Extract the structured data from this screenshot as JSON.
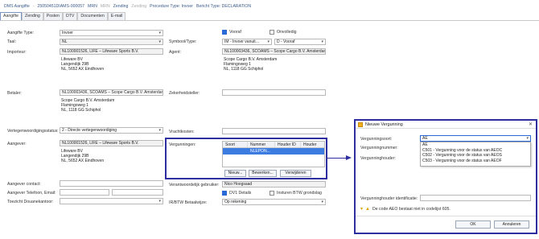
{
  "titlebar": {
    "app": "DMS Aangifte",
    "ref": "25050451DIAMS-000057",
    "mrn_label": "MRN",
    "mrn_value": "MRN",
    "zending_label": "Zending",
    "zending_value": "Zending",
    "procedure": "Procedure Type: Invoer",
    "bericht": "Bericht Type: DECLARATION"
  },
  "tabs": [
    "Aangifte",
    "Zending",
    "Posten",
    "DTV",
    "Documenten",
    "E-mail"
  ],
  "form": {
    "aangifte_type_label": "Aangifte Type:",
    "aangifte_type_value": "Invoer",
    "taal_label": "Taal:",
    "taal_value": "NL",
    "importeur_label": "Importeur:",
    "importeur_value": "NL100001526, LIFE – Lifeware Sports B.V.",
    "importeur_addr": [
      "Lifeware BV",
      "Langendijk 29B",
      "NL, 5652 AX Eindhoven"
    ],
    "betaler_label": "Betaler:",
    "betaler_value": "NL100003436, SCOAMS – Scope Cargo B.V. Amsterdam",
    "betaler_addr": [
      "Scope Cargo B.V. Amsterdam",
      "Flamingoweg 1",
      "NL, 1118 GG Schiphol"
    ],
    "vertegenwoordiging_label": "Vertegenwoordigingsstatus:",
    "vertegenwoordiging_value": "2 - Directe vertegenwoordiging",
    "aangever_label": "Aangever:",
    "aangever_value": "NL100001526, LIFE – Lifeware Sports B.V.",
    "aangever_addr": [
      "Lifeware BV",
      "Langendijk 29B",
      "NL, 5652 AX Eindhoven"
    ],
    "contact_label": "Aangever contact:",
    "telefoon_label": "Aangever Telefoon, Email:",
    "toezicht_label": "Toezicht Douanekantoor:",
    "vooraf_label": "Vooraf",
    "onvolledig_label": "Onvolledig",
    "symbool_label": "Symbool/Type:",
    "symbool_value": "IM - Invoer vanuit…",
    "type_value": "D - Vooraf",
    "agent_label": "Agent:",
    "agent_value": "NL100003436, SCOAMS – Scope Cargo B.V. Amsterdam",
    "agent_addr": [
      "Scope Cargo B.V. Amsterdam",
      "Flamingoweg 1",
      "NL, 1118 GG Schiphol"
    ],
    "zekerheid_label": "Zekerheidsteller:",
    "vrachtkosten_label": "Vrachtkosten:",
    "vergunningen_label": "Vergunningen:",
    "grid_cols": [
      "Soort",
      "Nummer",
      "Houder ID",
      "Houder"
    ],
    "grid_row_value": "NLEPON...",
    "nieuw_btn": "Nieuw...",
    "bewerken_btn": "Bewerken...",
    "verwijderen_btn": "Verwijderen",
    "verantwoordelijk_label": "Verantwoordelijk gebruiker:",
    "verantwoordelijk_value": "Nico Hoogsaad",
    "dv1_label": "DV1 Details",
    "insturen_label": "Insturen BTW grondslag",
    "btw_label": "IR/BTW Betaalwijze:",
    "btw_value": "Op rekening"
  },
  "dialog": {
    "title": "Nieuwe Vergunning",
    "soort_label": "Vergunningsoort:",
    "soort_value": "AE",
    "nummer_label": "Vergunningnummer:",
    "houder_label": "Vergunninghouder:",
    "houder_id_label": "Vergunninghouder identificatie:",
    "options": [
      "AE",
      "C501 - Vergunning voor de status van AEOC",
      "C502 - Vergunning voor de status van AEOS",
      "C503 - Vergunning voor de status van AEOF"
    ],
    "warning": "De code AEO bestaat niet in codelijst 605.",
    "ok_btn": "OK",
    "annuleren_btn": "Annuleren"
  },
  "colors": {
    "accent": "#2a6ad4",
    "highlight": "#2d2fa0",
    "selection": "#3c7be0"
  }
}
